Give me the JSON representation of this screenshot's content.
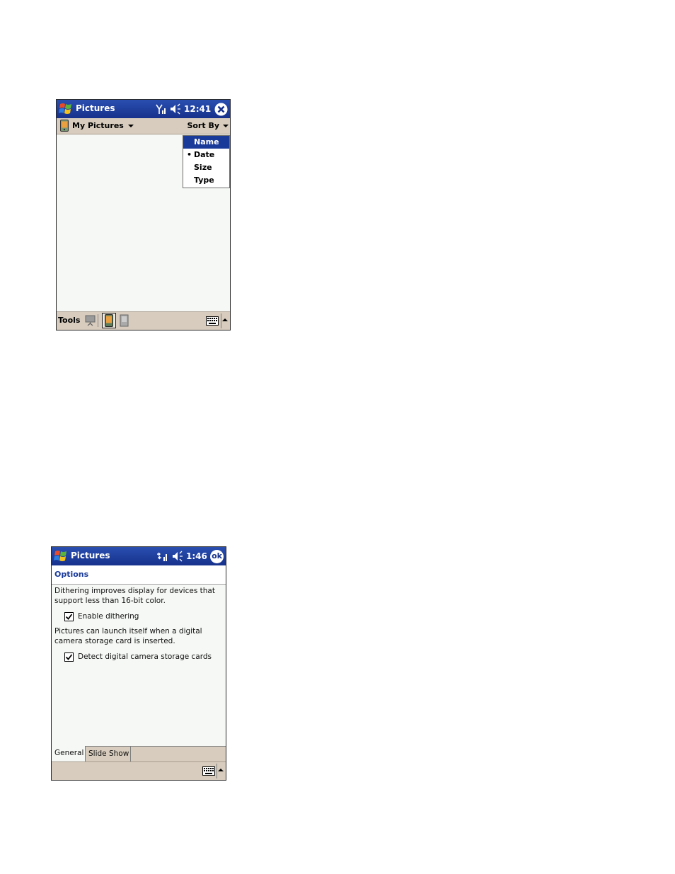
{
  "screen1": {
    "title": "Pictures",
    "time": "12:41",
    "status_icons": [
      "antenna-icon",
      "speaker-icon"
    ],
    "close_icon": "close-x-icon",
    "folder_label": "My Pictures",
    "sort_by_label": "Sort By",
    "sort_menu": {
      "items": [
        "Name",
        "Date",
        "Size",
        "Type"
      ],
      "highlighted": "Name",
      "checked": "Date"
    },
    "toolbar": {
      "tools_label": "Tools",
      "icons": [
        "slideshow-icon",
        "device-icon",
        "storage-card-icon",
        "keyboard-icon"
      ]
    }
  },
  "screen2": {
    "title": "Pictures",
    "time": "1:46",
    "ok_label": "ok",
    "options_title": "Options",
    "dither_text": "Dithering improves display for devices that support less than 16-bit color.",
    "enable_dithering": {
      "label": "Enable dithering",
      "checked": true
    },
    "launch_text": "Pictures can launch itself when a digital camera storage card is inserted.",
    "detect_cards": {
      "label": "Detect digital camera storage cards",
      "checked": true
    },
    "tabs": [
      "General",
      "Slide Show"
    ],
    "active_tab": "General"
  },
  "colors": {
    "title_bar": "#1f3f9f",
    "menu_bar": "#d7ccbd",
    "content_bg": "#f5f8f4",
    "highlight": "#1a3a99",
    "options_title": "#1a3a99"
  }
}
